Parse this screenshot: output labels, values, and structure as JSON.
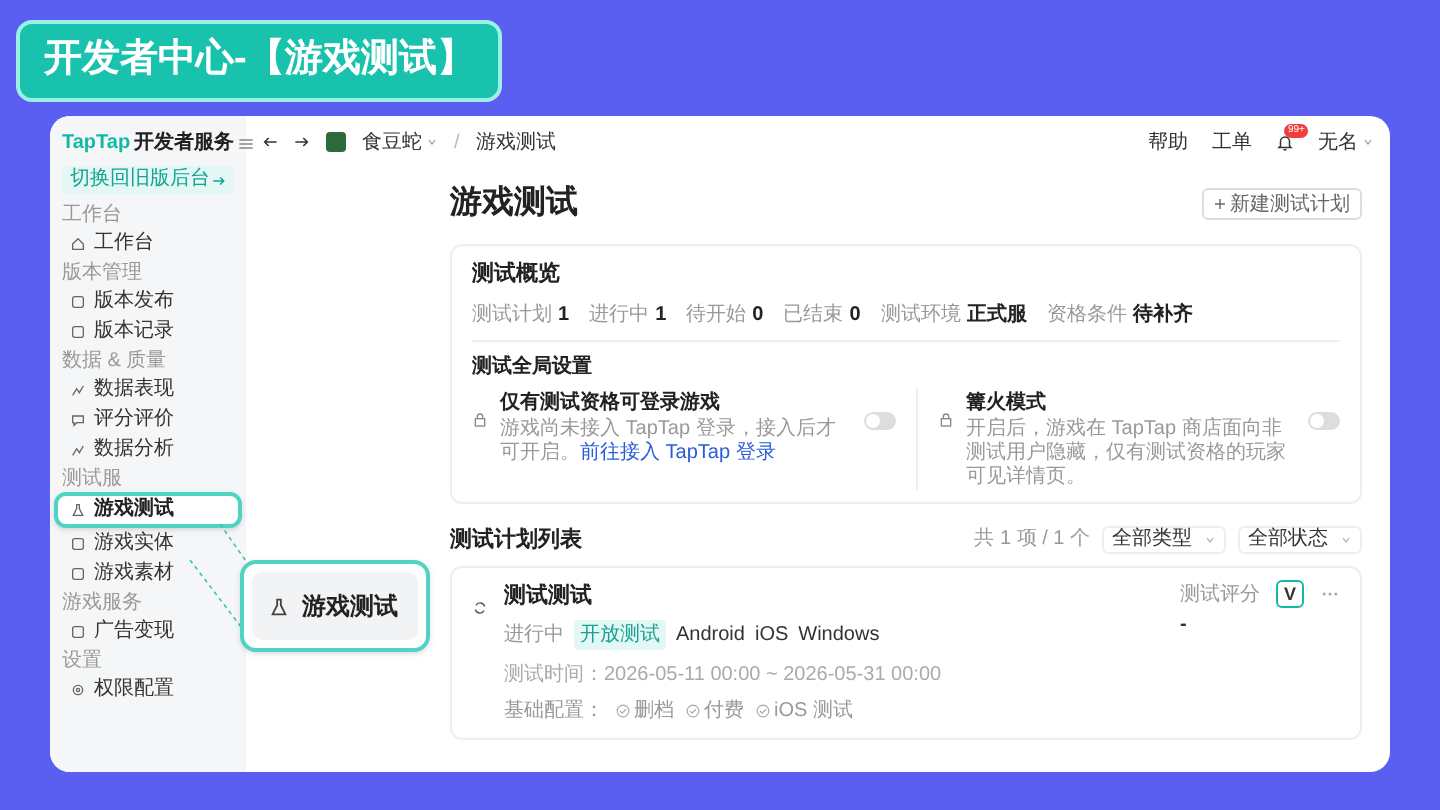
{
  "banner_title": "开发者中心-【游戏测试】",
  "sidebar": {
    "logo": "TapTap",
    "logo_suffix": "开发者服务",
    "switch_button": "切换回旧版后台",
    "sections": [
      {
        "title": "工作台",
        "items": [
          {
            "label": "工作台",
            "selected": false
          }
        ]
      },
      {
        "title": "版本管理",
        "items": [
          {
            "label": "版本发布",
            "selected": false
          },
          {
            "label": "版本记录",
            "selected": false
          }
        ]
      },
      {
        "title": "数据 & 质量",
        "items": [
          {
            "label": "数据表现",
            "selected": false
          },
          {
            "label": "评分评价",
            "selected": false
          },
          {
            "label": "数据分析",
            "selected": false
          }
        ]
      },
      {
        "title": "测试服",
        "items": [
          {
            "label": "游戏测试",
            "selected": true
          },
          {
            "label": "游戏实体",
            "selected": false
          },
          {
            "label": "游戏素材",
            "selected": false
          }
        ]
      },
      {
        "title": "游戏服务",
        "items": [
          {
            "label": "广告变现",
            "selected": false
          }
        ]
      },
      {
        "title": "设置",
        "items": [
          {
            "label": "权限配置",
            "selected": false
          }
        ]
      }
    ]
  },
  "topbar": {
    "app_name": "食豆蛇",
    "separator": "/",
    "page": "游戏测试",
    "links": [
      "帮助",
      "工单"
    ],
    "notification_badge": "99+",
    "user": "无名"
  },
  "page_title": "游戏测试",
  "new_button": "新建测试计划",
  "overview": {
    "title": "测试概览",
    "stats": [
      {
        "label": "测试计划",
        "value": "1"
      },
      {
        "label": "进行中",
        "value": "1"
      },
      {
        "label": "待开始",
        "value": "0"
      },
      {
        "label": "已结束",
        "value": "0"
      },
      {
        "label": "测试环境",
        "value": "正式服"
      },
      {
        "label": "资格条件",
        "value": "待补齐"
      }
    ],
    "settings_title": "测试全局设置",
    "settings": [
      {
        "title": "仅有测试资格可登录游戏",
        "description": "游戏尚未接入 TapTap 登录，接入后才可开启。",
        "link": "前往接入 TapTap 登录",
        "on": false
      },
      {
        "title": "篝火模式",
        "description": "开启后，游戏在 TapTap 商店面向非测试用户隐藏，仅有测试资格的玩家可见详情页。",
        "on": false
      }
    ]
  },
  "plans": {
    "title": "测试计划列表",
    "count": "共 1 项 / 1 个",
    "filters": [
      "全部类型",
      "全部状态"
    ],
    "items": [
      {
        "name": "测试测试",
        "status": "进行中",
        "tag": "开放测试",
        "platforms": [
          "Android",
          "iOS",
          "Windows"
        ],
        "time": "测试时间：2026-05-11 00:00 ~ 2026-05-31 00:00",
        "config_label": "基础配置：",
        "config": [
          "删档",
          "付费",
          "iOS 测试"
        ],
        "score_label": "测试评分",
        "score": "-",
        "action": "V"
      }
    ]
  },
  "callout": {
    "label": "游戏测试"
  }
}
